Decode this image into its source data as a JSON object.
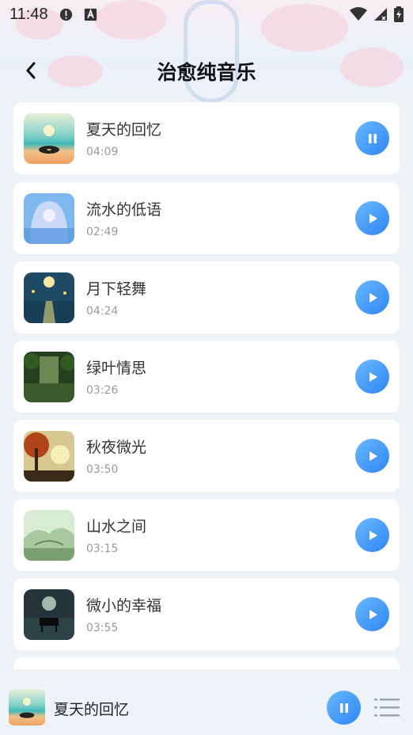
{
  "status_bar": {
    "time": "11:48"
  },
  "header": {
    "title": "治愈纯音乐"
  },
  "songs": [
    {
      "title": "夏天的回忆",
      "duration": "04:09",
      "state": "playing",
      "cover": "beach-record"
    },
    {
      "title": "流水的低语",
      "duration": "02:49",
      "state": "paused",
      "cover": "cave-water"
    },
    {
      "title": "月下轻舞",
      "duration": "04:24",
      "state": "paused",
      "cover": "moon-night"
    },
    {
      "title": "绿叶情思",
      "duration": "03:26",
      "state": "paused",
      "cover": "green-forest"
    },
    {
      "title": "秋夜微光",
      "duration": "03:50",
      "state": "paused",
      "cover": "autumn-tree"
    },
    {
      "title": "山水之间",
      "duration": "03:15",
      "state": "paused",
      "cover": "misty-mountain"
    },
    {
      "title": "微小的幸福",
      "duration": "03:55",
      "state": "paused",
      "cover": "piano-lake"
    }
  ],
  "mini_player": {
    "title": "夏天的回忆",
    "state": "playing"
  },
  "colors": {
    "accent": "#2f86f2",
    "background": "#eef2f7"
  }
}
